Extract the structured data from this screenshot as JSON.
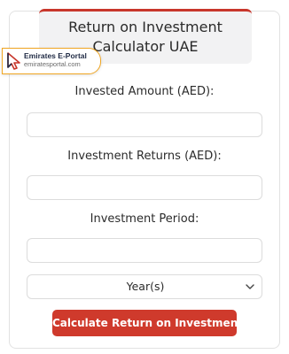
{
  "title": {
    "line1": "Return on Investment",
    "line2": "Calculator UAE"
  },
  "watermark": {
    "name": "Emirates E-Portal",
    "url": "emiratesportal.com",
    "icon": "cursor-arrow-icon"
  },
  "form": {
    "invested_label": "Invested Amount (AED):",
    "invested_value": "",
    "returns_label": "Investment Returns (AED):",
    "returns_value": "",
    "period_label": "Investment Period:",
    "period_value": "",
    "period_unit_selected": "Year(s)",
    "submit_label": "Calculate Return on Investment"
  },
  "colors": {
    "accent": "#cf3a2c",
    "title_bg": "#f2f2f3",
    "watermark_border": "#f0a623"
  }
}
